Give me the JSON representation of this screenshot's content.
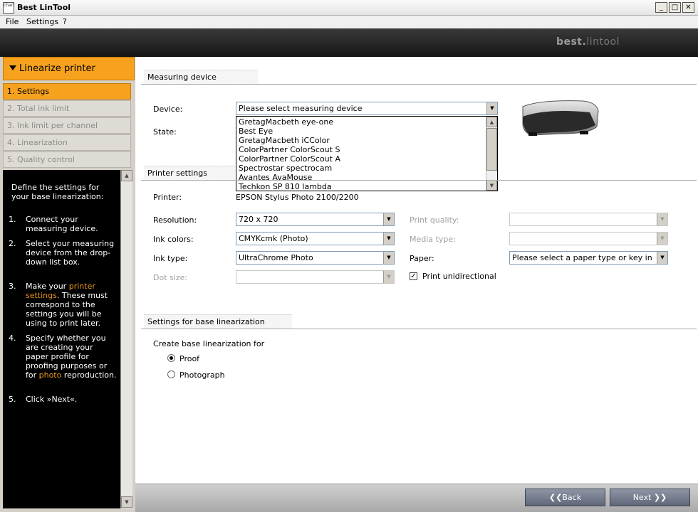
{
  "window": {
    "title": "Best LinTool",
    "icon_text": "chart"
  },
  "menu": {
    "items": [
      "File",
      "Settings",
      "?"
    ]
  },
  "brand": {
    "main": "best.",
    "sub": "lintool"
  },
  "left": {
    "header": "Linearize printer",
    "steps": [
      "1. Settings",
      "2. Total ink limit",
      "3. Ink limit per channel",
      "4. Linearization",
      "5. Quality control"
    ],
    "active_step": 0,
    "help": {
      "intro": "Define the settings for your base linearization:",
      "items": [
        {
          "n": "1.",
          "parts": [
            "Connect your measuring device."
          ]
        },
        {
          "n": "2.",
          "parts": [
            "Select your measuring device from the drop-down list box."
          ]
        },
        {
          "n": "3.",
          "pre": "Make your ",
          "link": "printer settings",
          "post": ". These must correspond to the settings you will be using to print later."
        },
        {
          "n": "4.",
          "pre": "Specify whether you are creating your paper profile for proofing purposes or for ",
          "link": "photo",
          "post": " reproduction."
        },
        {
          "n": "5.",
          "parts": [
            "Click »Next«."
          ]
        }
      ]
    }
  },
  "measuring": {
    "section": "Measuring device",
    "device_label": "Device:",
    "device_value": "Please select measuring device",
    "state_label": "State:",
    "options": [
      "GretagMacbeth eye-one",
      "Best Eye",
      "GretagMacbeth iCColor",
      "ColorPartner ColorScout S",
      "ColorPartner ColorScout A",
      "Spectrostar spectrocam",
      "Avantes AvaMouse",
      "Techkon SP 810 lambda"
    ]
  },
  "printer": {
    "section": "Printer settings",
    "printer_label": "Printer:",
    "printer_value": "EPSON Stylus Photo 2100/2200",
    "resolution_label": "Resolution:",
    "resolution_value": "720 x 720",
    "ink_colors_label": "Ink colors:",
    "ink_colors_value": "CMYKcmk (Photo)",
    "ink_type_label": "Ink type:",
    "ink_type_value": "UltraChrome Photo",
    "dot_size_label": "Dot size:",
    "dot_size_value": "",
    "print_quality_label": "Print quality:",
    "print_quality_value": "",
    "media_type_label": "Media type:",
    "media_type_value": "",
    "paper_label": "Paper:",
    "paper_value": "Please select a paper type or key in",
    "unidirectional_label": "Print unidirectional",
    "unidirectional_checked": true
  },
  "base": {
    "section": "Settings for base linearization",
    "create_label": "Create base linearization for",
    "options": [
      "Proof",
      "Photograph"
    ],
    "selected": 0
  },
  "nav": {
    "back": "Back",
    "next": "Next"
  },
  "colors": {
    "accent": "#f6a21e",
    "nav_button": "#6e7688"
  }
}
